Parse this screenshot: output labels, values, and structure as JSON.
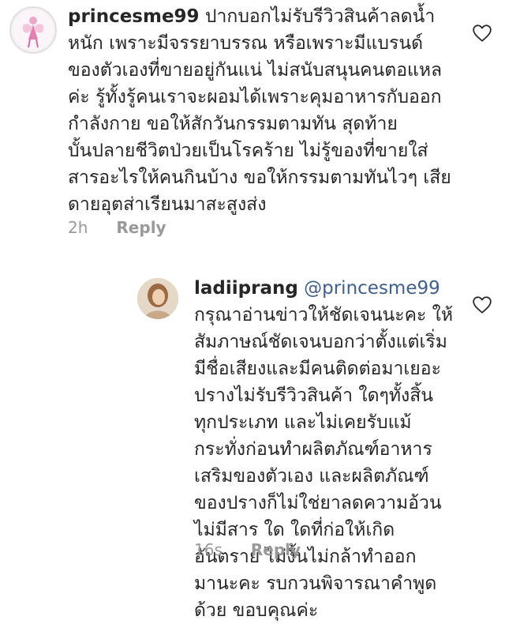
{
  "comments": [
    {
      "username": "princesme99",
      "text": " ปากบอกไม่รับรีวิวสินค้าลดน้ำหนัก เพราะมีจรรยาบรรณ หรือเพราะมีแบรนด์ของตัวเองที่ขายอยู่กันแน่ ไม่สนับสนุนคนตอแหลค่ะ รู้ทั้งรู้คนเราจะผอมได้เพราะคุมอาหารกับออกกำลังกาย ขอให้สักวันกรรมตามทัน สุดท้ายบั้นปลายชีวิตป่วยเป็นโรคร้าย ไม่รู้ของที่ขายใส่สารอะไรให้คนกินบ้าง ขอให้กรรมตามทันไวๆ เสียดายอุตส่าเรียนมาสะสูงส่ง",
      "time": "2h",
      "reply_label": "Reply"
    },
    {
      "username": "ladiiprang",
      "mention": "@princesme99",
      "text": " กรุณาอ่านข่าวให้ชัดเจนนะคะ ให้สัมภาษณ์ชัดเจนบอกว่าตั้งแต่เริ่มมีชื่อเสียงและมีคนติดต่อมาเยอะ ปรางไม่รับรีวิวสินค้า ใดๆทั้งสิ้นทุกประเภท และไม่เคยรับแม้กระทั่งก่อนทำผลิตภัณฑ์อาหารเสริมของตัวเอง และผลิตภัณฑ์ของปรางก็ไม่ใช่ยาลดความอ้วน ไม่มีสาร ใด ใดที่ก่อให้เกิดอันตราย ไม่งั้นไม่กล้าทำออกมานะคะ รบกวนพิจารณาคำพูดด้วย ขอบคุณค่ะ",
      "time": "16s",
      "reply_label": "Reply"
    }
  ]
}
